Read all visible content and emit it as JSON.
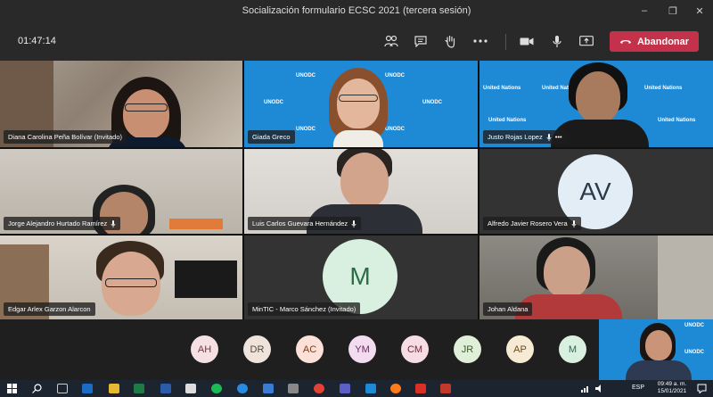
{
  "window": {
    "title": "Socialización formulario ECSC 2021 (tercera sesión)",
    "controls": [
      "–",
      "❐",
      "✕"
    ]
  },
  "toolbar": {
    "timer": "01:47:14",
    "leave_label": "Abandonar"
  },
  "tiles": [
    {
      "name": "Diana Carolina Peña Bolívar (Invitado)"
    },
    {
      "name": "Giada Greco"
    },
    {
      "name": "Justo Rojas Lopez",
      "more": "•••"
    },
    {
      "name": "Jorge Alejandro Hurtado Ramírez"
    },
    {
      "name": "Luis Carlos Guevara Hernández"
    },
    {
      "name": "Alfredo Javier Rosero Vera",
      "initials": "AV"
    },
    {
      "name": "Edgar Arlex Garzon Alarcon"
    },
    {
      "name": "MinTIC - Marco Sánchez (Invitado)",
      "initials": "M"
    },
    {
      "name": "Johan Aldana"
    }
  ],
  "watermark": {
    "org": "UNODC",
    "alt": "United Nations"
  },
  "participants": [
    "AH",
    "DR",
    "AC",
    "YM",
    "CM",
    "JR",
    "AP",
    "M"
  ],
  "colors": {
    "leave": "#c4314b",
    "unodc_blue": "#1e8ad6",
    "avatar_light": "#d9efe0",
    "avatar_text": "#2e6b47"
  },
  "taskbar": {
    "time": "09:49 a. m.",
    "date": "15/01/2021",
    "lang": "ESP"
  }
}
